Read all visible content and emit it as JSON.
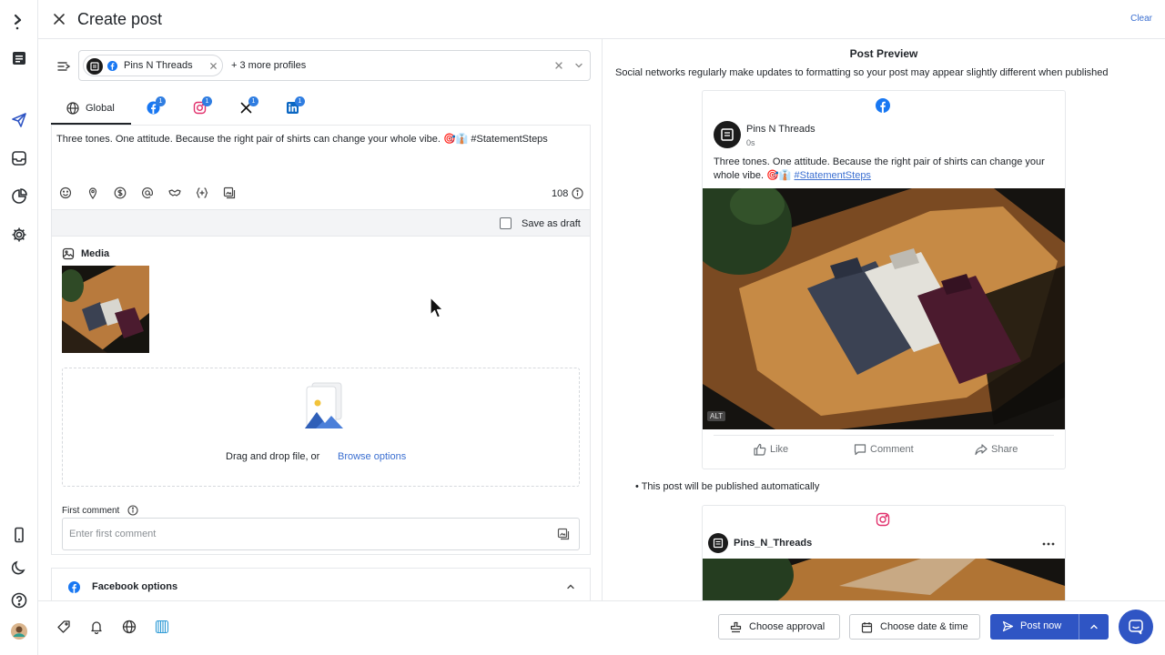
{
  "header": {
    "title": "Create post",
    "clear_label": "Clear"
  },
  "sidebar": {
    "icons": [
      "logo-icon",
      "calendar-icon",
      "send-icon",
      "inbox-icon",
      "analytics-icon",
      "settings-icon",
      "mobile-icon",
      "dark-mode-icon",
      "help-icon",
      "avatar"
    ]
  },
  "profiles": {
    "selected_profile": "Pins N Threads",
    "more_label": "+ 3 more profiles"
  },
  "tabs": {
    "global_label": "Global",
    "networks": [
      {
        "name": "facebook",
        "badge": "1"
      },
      {
        "name": "instagram",
        "badge": "1"
      },
      {
        "name": "x",
        "badge": "1"
      },
      {
        "name": "linkedin",
        "badge": "1"
      }
    ]
  },
  "editor": {
    "text": "Three tones. One attitude. Because the right pair of shirts can change your whole vibe. 🎯👔 #StatementSteps",
    "char_count": "108",
    "save_draft_label": "Save as draft"
  },
  "media": {
    "label": "Media",
    "drop_text": "Drag and drop file, or",
    "browse_label": "Browse options"
  },
  "first_comment": {
    "label": "First comment",
    "placeholder": "Enter first comment"
  },
  "facebook_options": {
    "label": "Facebook options"
  },
  "preview": {
    "title": "Post Preview",
    "note": "Social networks regularly make updates to formatting so your post may appear slightly different when published",
    "facebook": {
      "name": "Pins N Threads",
      "time": "0s",
      "text": "Three tones. One attitude. Because the right pair of shirts can change your whole vibe. 🎯👔",
      "hashtag": "#StatementSteps",
      "alt_badge": "ALT",
      "like_label": "Like",
      "comment_label": "Comment",
      "share_label": "Share"
    },
    "auto_note": "• This post will be published automatically",
    "instagram": {
      "name": "Pins_N_Threads"
    }
  },
  "footer": {
    "approval_label": "Choose approval",
    "date_label": "Choose date & time",
    "post_label": "Post now"
  },
  "colors": {
    "primary": "#2f55c4",
    "link": "#3b6fd1",
    "facebook": "#1877f2",
    "linkedin": "#0a66c2",
    "instagram": "#e1306c",
    "badge": "#2f7de1"
  }
}
